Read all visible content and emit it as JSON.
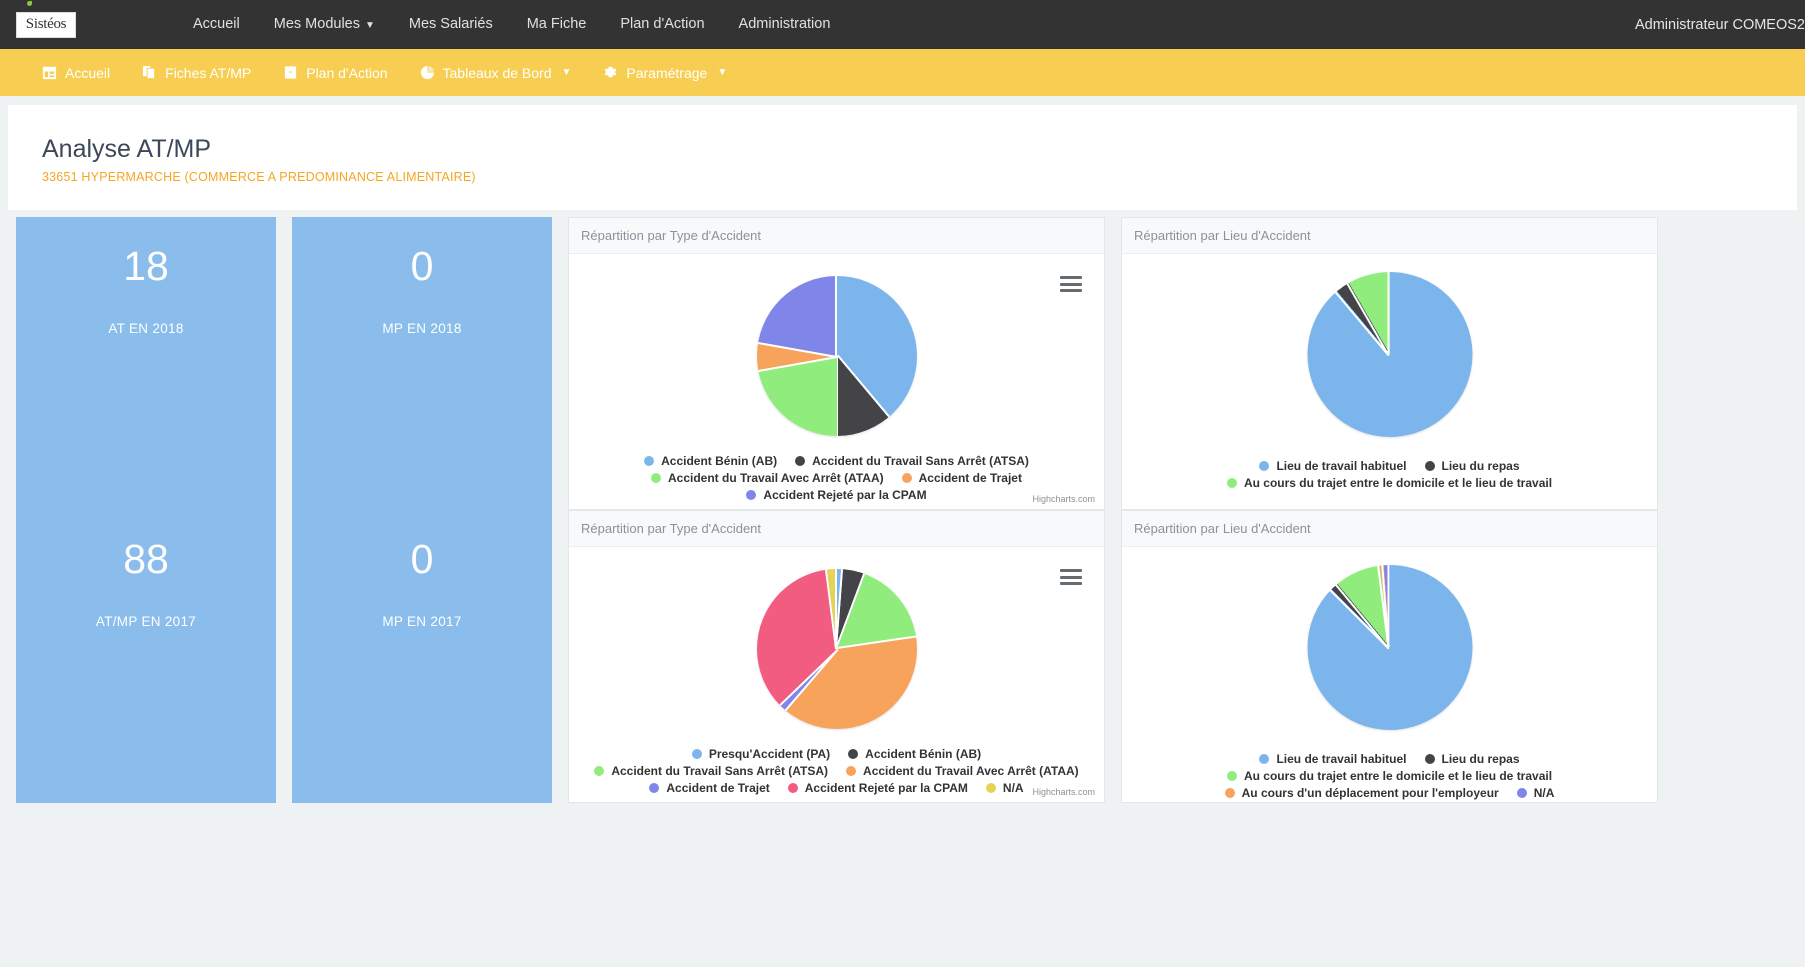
{
  "topnav": {
    "brand": "Sistéos",
    "links": [
      {
        "label": "Accueil",
        "caret": false
      },
      {
        "label": "Mes Modules",
        "caret": true
      },
      {
        "label": "Mes Salariés",
        "caret": false
      },
      {
        "label": "Ma Fiche",
        "caret": false
      },
      {
        "label": "Plan d'Action",
        "caret": false
      },
      {
        "label": "Administration",
        "caret": false
      }
    ],
    "user": "Administrateur COMEOS2",
    "caret_glyph": "▼"
  },
  "subnav": {
    "items": [
      {
        "label": "Accueil",
        "icon": "calendar-icon",
        "glyph": "▦",
        "caret": false
      },
      {
        "label": "Fiches AT/MP",
        "icon": "copy-icon",
        "glyph": "❐",
        "caret": false
      },
      {
        "label": "Plan d'Action",
        "icon": "book-icon",
        "glyph": "Ὅ6",
        "caret": false
      },
      {
        "label": "Tableaux de Bord",
        "icon": "pie-chart-icon",
        "glyph": "◔",
        "caret": true
      },
      {
        "label": "Paramétrage",
        "icon": "gear-icon",
        "glyph": "⚙",
        "caret": true
      }
    ],
    "caret_glyph": "▼"
  },
  "header": {
    "title": "Analyse AT/MP",
    "subtitle": "33651 HYPERMARCHE (COMMERCE A PREDOMINANCE ALIMENTAIRE)",
    "accent_color": "#f5a623"
  },
  "kpis": [
    {
      "value": "18",
      "label": "AT EN 2018",
      "color": "#8ABDEB"
    },
    {
      "value": "0",
      "label": "MP EN 2018",
      "color": "#8ABDEB"
    },
    {
      "value": "88",
      "label": "AT/MP EN 2017",
      "color": "#8ABDEB"
    },
    {
      "value": "0",
      "label": "MP EN 2017",
      "color": "#8ABDEB"
    }
  ],
  "credit": "Highcharts.com",
  "chart_data": [
    {
      "id": "type-2018",
      "type": "pie",
      "title": "Répartition par Type d'Accident",
      "legend_position": "bottom",
      "categories": [
        "Accident Bénin (AB)",
        "Accident du Travail Sans Arrêt (ATSA)",
        "Accident du Travail Avec Arrêt (ATAA)",
        "Accident de Trajet",
        "Accident Rejeté par la CPAM"
      ],
      "values": [
        38.9,
        11.1,
        22.2,
        5.6,
        22.2
      ],
      "colors": [
        "#7cb5ec",
        "#434348",
        "#90ed7d",
        "#f7a35c",
        "#8085e9"
      ],
      "has_export_menu": true
    },
    {
      "id": "lieu-2018",
      "type": "pie",
      "title": "Répartition par Lieu d'Accident",
      "legend_position": "bottom",
      "categories": [
        "Lieu de travail habituel",
        "Lieu du repas",
        "Au cours du trajet entre le domicile et le lieu de travail"
      ],
      "values": [
        88.9,
        2.8,
        8.3
      ],
      "colors": [
        "#7cb5ec",
        "#434348",
        "#90ed7d"
      ],
      "has_export_menu": false
    },
    {
      "id": "type-2017",
      "type": "pie",
      "title": "Répartition par Type d'Accident",
      "legend_position": "bottom",
      "categories": [
        "Presqu'Accident (PA)",
        "Accident Bénin (AB)",
        "Accident du Travail Sans Arrêt (ATSA)",
        "Accident du Travail Avec Arrêt (ATAA)",
        "Accident de Trajet",
        "Accident Rejeté par la CPAM",
        "N/A"
      ],
      "values": [
        1.2,
        4.5,
        17.0,
        38.6,
        1.5,
        35.2,
        2.0
      ],
      "colors": [
        "#7cb5ec",
        "#434348",
        "#90ed7d",
        "#f7a35c",
        "#8085e9",
        "#f15c80",
        "#e4d354"
      ],
      "has_export_menu": true
    },
    {
      "id": "lieu-2017",
      "type": "pie",
      "title": "Répartition par Lieu d'Accident",
      "legend_position": "bottom",
      "categories": [
        "Lieu de travail habituel",
        "Lieu du repas",
        "Au cours du trajet entre le domicile et le lieu de travail",
        "Au cours d'un déplacement pour l'employeur",
        "N/A"
      ],
      "values": [
        87.5,
        1.5,
        9.0,
        0.8,
        1.2
      ],
      "colors": [
        "#7cb5ec",
        "#434348",
        "#90ed7d",
        "#f7a35c",
        "#8085e9"
      ],
      "has_export_menu": false
    }
  ]
}
